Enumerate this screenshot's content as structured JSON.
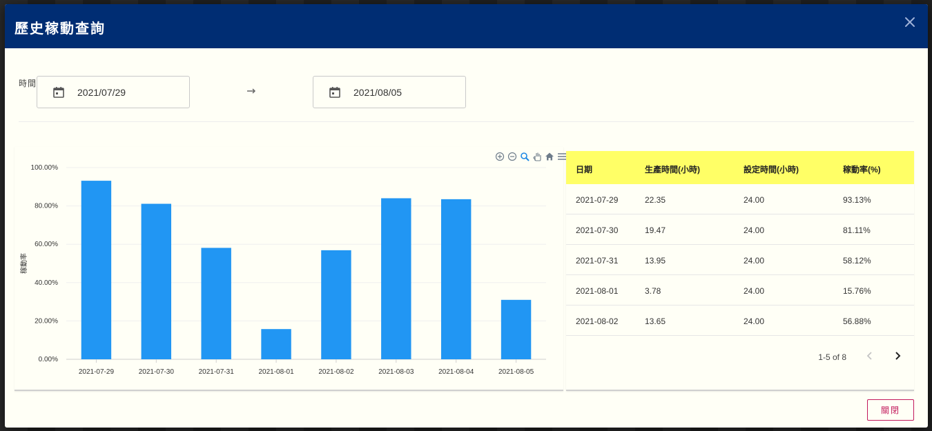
{
  "dialog": {
    "title": "歷史稼動查詢",
    "colors": {
      "header": "#002d73",
      "bar": "#2196f3",
      "table_header": "#ffff66",
      "close_button": "#c2185b"
    }
  },
  "filters": {
    "time_label": "時間",
    "start_date": "2021/07/29",
    "end_date": "2021/08/05"
  },
  "chart_toolbar": {
    "icons": [
      "zoom-in-icon",
      "zoom-out-icon",
      "zoom-selection-icon",
      "pan-hand-icon",
      "home-reset-icon",
      "menu-icon"
    ]
  },
  "chart_data": {
    "type": "bar",
    "categories": [
      "2021-07-29",
      "2021-07-30",
      "2021-07-31",
      "2021-08-01",
      "2021-08-02",
      "2021-08-03",
      "2021-08-04",
      "2021-08-05"
    ],
    "values": [
      93.13,
      81.11,
      58.12,
      15.76,
      56.88,
      84.0,
      83.5,
      31.0
    ],
    "ylabel": "稼動率",
    "ylim": [
      0,
      100
    ],
    "y_ticks": [
      "0.00%",
      "20.00%",
      "40.00%",
      "60.00%",
      "80.00%",
      "100.00%"
    ],
    "grid": true
  },
  "table": {
    "headers": [
      "日期",
      "生產時間(小時)",
      "設定時間(小時)",
      "稼動率(%)"
    ],
    "rows": [
      [
        "2021-07-29",
        "22.35",
        "24.00",
        "93.13%"
      ],
      [
        "2021-07-30",
        "19.47",
        "24.00",
        "81.11%"
      ],
      [
        "2021-07-31",
        "13.95",
        "24.00",
        "58.12%"
      ],
      [
        "2021-08-01",
        "3.78",
        "24.00",
        "15.76%"
      ],
      [
        "2021-08-02",
        "13.65",
        "24.00",
        "56.88%"
      ]
    ],
    "pagination": "1-5 of 8"
  },
  "footer": {
    "close_label": "關閉"
  }
}
